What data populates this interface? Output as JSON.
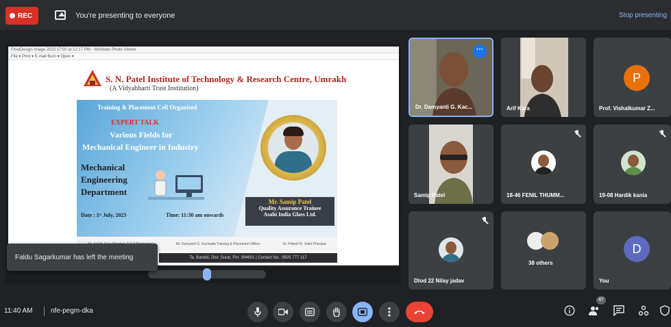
{
  "header": {
    "rec_label": "REC",
    "presenting_text": "You're presenting to everyone",
    "stop_label": "Stop presenting"
  },
  "slide": {
    "window_title": "FinalDesign Image 2023 17:00 at 12:17 PM - Windows Photo Viewer",
    "menu": "File ▾  Print ▾  E-mail  Burn ▾  Open ▾",
    "institute": "S. N. Patel Institute of Technology & Research Centre, Umrakh",
    "institute_sub": "(A Vidyabharti Trust Institution)",
    "cell": "Training & Placement Cell Organised",
    "expert": "EXPERT TALK",
    "fields_line": "Various Fields for",
    "mech_line": "Mechanical Engineer in Industry",
    "department": "Mechanical Engineering Department",
    "date": "Date : 1ˢᵗ July, 2023",
    "time": "Time: 11:30 am onwards",
    "speaker_name": "Mr. Samip Patel",
    "speaker_role": "Quality Assurance Trainee",
    "speaker_org": "Asahi India Glass Ltd.",
    "footer_1": "Mr. Arif M. Kara  Member, T & P Mechanical",
    "footer_2": "Mr. Damyanti G. Kachadia  Training & Placement Officer",
    "footer_3": "Dr. Pritesh N. Joshi  Principal",
    "address": "Ta. Bardoli, Dist: Surat, Pin: 394601 | Contact No.: 9925 777 117"
  },
  "toast": "Faldu Sagarkumar has left the meeting",
  "participants": [
    {
      "name": "Dr. Damyanti G. Kac...",
      "type": "video",
      "active": true
    },
    {
      "name": "Arif Kara",
      "type": "video"
    },
    {
      "name": "Prof. Vishalkumar Z...",
      "type": "letter",
      "letter": "P",
      "color": "#e8710a"
    },
    {
      "name": "Samip Patel",
      "type": "video"
    },
    {
      "name": "18-46 FENIL THUMM...",
      "type": "photo",
      "muted": true
    },
    {
      "name": "19-08 Hardik kania",
      "type": "photo",
      "muted": true
    },
    {
      "name": "Dtod 22 Nilay jadav",
      "type": "photo",
      "muted": true
    },
    {
      "name": "38 others",
      "type": "group"
    },
    {
      "name": "You",
      "type": "letter",
      "letter": "D",
      "color": "#5c6bc0"
    }
  ],
  "footer": {
    "time": "11:40 AM",
    "meeting_code": "nfe-pegm-dka",
    "people_count": "47"
  },
  "colors": {
    "rec": "#d93025",
    "end_call": "#ea4335",
    "active_control": "#8ab4f8"
  }
}
